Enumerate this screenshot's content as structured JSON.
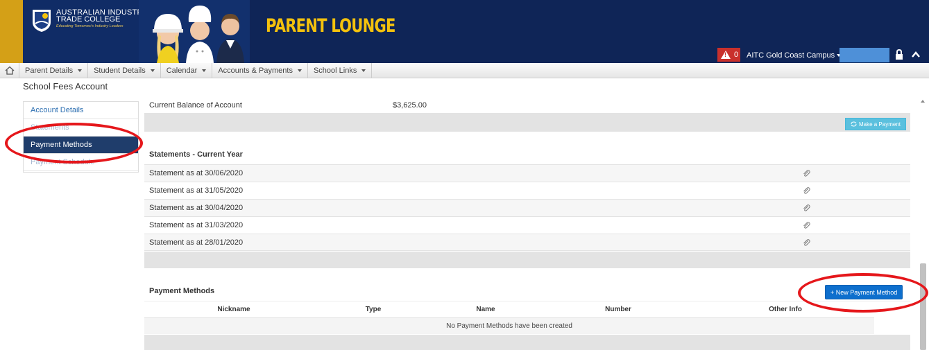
{
  "header": {
    "logo_line1": "AUSTRALIAN INDUSTRY",
    "logo_line2": "TRADE COLLEGE",
    "logo_tagline": "Educating Tomorrow's Industry Leaders",
    "site_title": "PARENT LOUNGE",
    "alert_count": "0",
    "campus": "AITC Gold Coast Campus",
    "colors": {
      "banner": "#0f2557",
      "title": "#f4c20d",
      "alert": "#c9302c"
    }
  },
  "nav": {
    "home_icon": "home-icon",
    "items": [
      {
        "label": "Parent Details"
      },
      {
        "label": "Student Details"
      },
      {
        "label": "Calendar"
      },
      {
        "label": "Accounts & Payments"
      },
      {
        "label": "School Links"
      }
    ]
  },
  "page": {
    "title": "School Fees Account"
  },
  "sidebar": {
    "items": [
      {
        "label": "Account Details"
      },
      {
        "label": "Statements"
      },
      {
        "label": "Payment Methods"
      },
      {
        "label": "Payment Schedule"
      }
    ],
    "active": "Payment Methods"
  },
  "account": {
    "balance_label": "Current Balance of Account",
    "balance_value": "$3,625.00",
    "make_payment_label": "Make a Payment"
  },
  "statements": {
    "title": "Statements - Current Year",
    "rows": [
      {
        "label": "Statement as at 30/06/2020"
      },
      {
        "label": "Statement as at 31/05/2020"
      },
      {
        "label": "Statement as at 30/04/2020"
      },
      {
        "label": "Statement as at 31/03/2020"
      },
      {
        "label": "Statement as at 28/01/2020"
      }
    ]
  },
  "payment_methods": {
    "title": "Payment Methods",
    "new_button_label": "+ New Payment Method",
    "columns": [
      "Nickname",
      "Type",
      "Name",
      "Number",
      "Other Info"
    ],
    "empty_message": "No Payment Methods have been created"
  },
  "annotations": {
    "color": "#e5171b"
  }
}
